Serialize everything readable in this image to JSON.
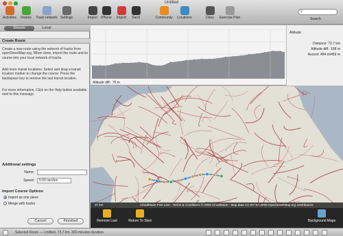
{
  "app_title": "Untitled",
  "toolbar": [
    {
      "label": "Activities",
      "icon": "activities-icon",
      "color": "#d66a2a"
    },
    {
      "label": "Routes",
      "icon": "routes-icon",
      "color": "#4aa33b"
    },
    {
      "label": "Track network",
      "icon": "track-network-icon",
      "color": "#8aa2c8"
    },
    {
      "label": "Settings",
      "icon": "gear-icon",
      "color": "#6a6a6a"
    },
    {
      "label": "Import",
      "icon": "watch-icon",
      "color": "#444444"
    },
    {
      "label": "iPhone",
      "icon": "watch-icon",
      "color": "#333333"
    },
    {
      "label": "Import",
      "icon": "watch-icon",
      "color": "#d23b3b"
    },
    {
      "label": "Send",
      "icon": "watch-icon",
      "color": "#333333"
    },
    {
      "label": "Community",
      "icon": "community-icon",
      "color": "#e98a1f"
    },
    {
      "label": "Locations",
      "icon": "locations-icon",
      "color": "#3d8ac4"
    },
    {
      "label": "Diary",
      "icon": "diary-icon",
      "color": "#555555"
    },
    {
      "label": "Exercise Plan",
      "icon": "exercise-plan-icon",
      "color": "#9a9a9a"
    }
  ],
  "search": {
    "value": ""
  },
  "search_label": "Search",
  "tabs": [
    {
      "label": "Streets"
    },
    {
      "label": "Local"
    }
  ],
  "create_route_title": "Create Route",
  "description": [
    "Create a new route using the network of tracks from openStreetMap.org. When done, import the route and its course into your local network of tracks.",
    "Add more transit locations. Select and drag a transit location marker to change the course. Press the backspace key to remove the last transit location.",
    "For more information, Click on the Help button available next to this message."
  ],
  "additional_settings_title": "Additional settings",
  "name_label": "Name:",
  "name_value": "",
  "speed_label": "Speed:",
  "speed_value": "5:00 min/km",
  "import_options_title": "Import Course Options",
  "radio_import": "Import as one piece",
  "radio_merge": "Merge with tracks",
  "import_selected": "radio_import",
  "cancel_label": "Cancel",
  "finished_label": "Finished",
  "chart_data": {
    "type": "area",
    "title": "Altitude:",
    "xlabel": "",
    "ylabel": "Altitude diff.: 75 m",
    "x": [
      0,
      3,
      6,
      9,
      12,
      15,
      18,
      21,
      24,
      27,
      30,
      33,
      36,
      39,
      42,
      45,
      48,
      51,
      54,
      57,
      60,
      63,
      66,
      69,
      72,
      73.7
    ],
    "series": [
      {
        "values": [
          20,
          20,
          20,
          23,
          24,
          24,
          25,
          24,
          20,
          20,
          25,
          26,
          28,
          29,
          30,
          30,
          31,
          33,
          34,
          35,
          37,
          38,
          40,
          42,
          42,
          40
        ]
      }
    ],
    "xlim": [
      0,
      73.7
    ],
    "ylim": [
      0,
      75
    ],
    "grid": true,
    "color": "#8b8f95"
  },
  "altitude_info": {
    "title": "Altitude:",
    "distance": "Distance: 73.7 km",
    "altitude_diff": "Altitude diff.: 168 m",
    "ascent": "Ascent: 484 m/459 m"
  },
  "map": {
    "scale": "37 km",
    "attribution": "CloudMade Fine Line - Terms & Conditions © 2009 CloudMade - Map data CC-BY-SA 2009 OpenStreetMap.org contributors",
    "water_color": "#aab8c6",
    "land_color": "#e3e0d6",
    "road_color": "#a83a3a"
  },
  "map_actions": {
    "remove_last": "Remove Last",
    "return_to_start": "Return To Start",
    "background_maps": "Background Maps"
  },
  "status_text": "Selected Route — Untitled, 73.7 km, 369 minutes duration.",
  "route_markers": [
    {
      "color": "#e8932c"
    },
    {
      "color": "#3d8ac4"
    },
    {
      "color": "#e8932c"
    },
    {
      "color": "#4aa33b"
    },
    {
      "color": "#e8932c"
    },
    {
      "color": "#3d8ac4"
    },
    {
      "color": "#e8932c"
    },
    {
      "color": "#e8932c"
    },
    {
      "color": "#3d8ac4"
    },
    {
      "color": "#e8932c"
    },
    {
      "color": "#4aa33b"
    }
  ],
  "altitude_marks": [
    0,
    0,
    0,
    0,
    0
  ]
}
